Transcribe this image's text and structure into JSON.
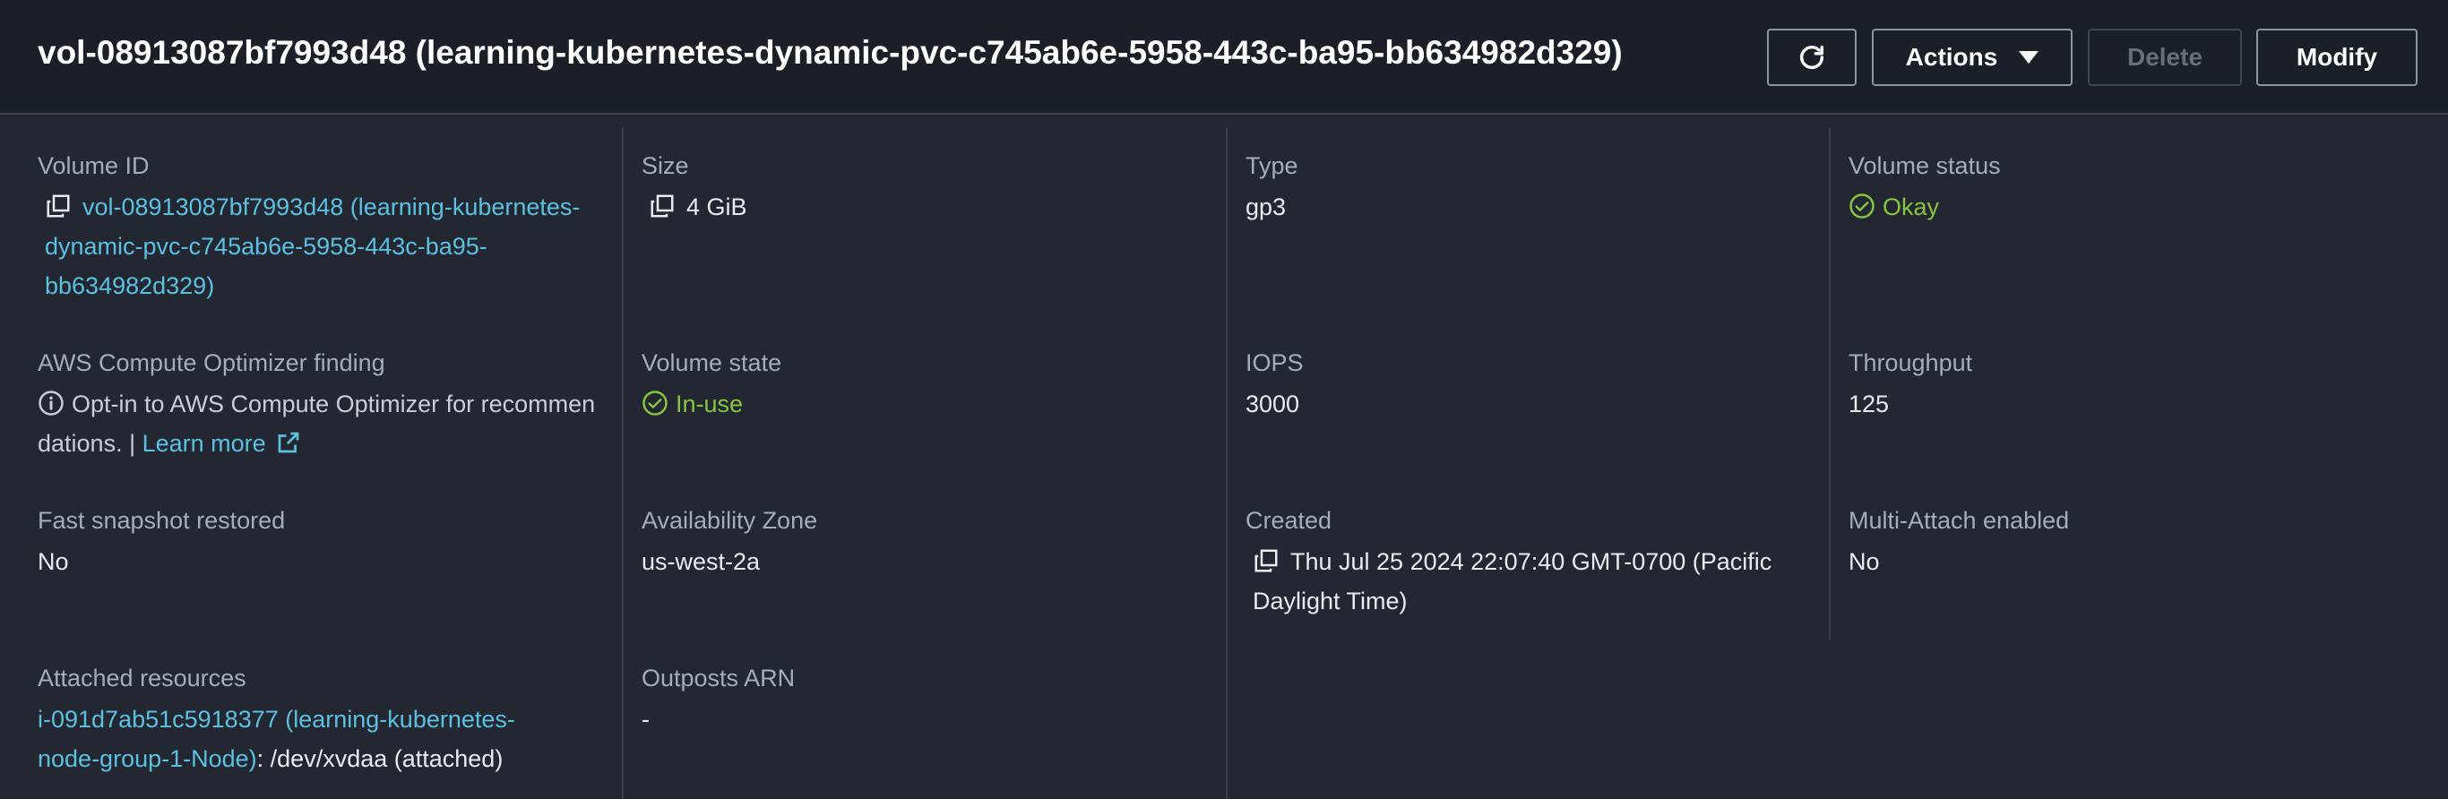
{
  "header": {
    "title": "vol-08913087bf7993d48 (learning-kubernetes-dynamic-pvc-c745ab6e-5958-443c-ba95-bb634982d329)",
    "refresh_icon": "refresh-icon",
    "actions_label": "Actions",
    "delete_label": "Delete",
    "modify_label": "Modify"
  },
  "details": {
    "volume_id": {
      "label": "Volume ID",
      "value": "vol-08913087bf7993d48 (learning-kubernetes-dynamic-pvc-c745ab6e-5958-443c-ba95-bb634982d329)",
      "icon": "copy-icon"
    },
    "size": {
      "label": "Size",
      "value": "4 GiB",
      "icon": "copy-icon"
    },
    "type": {
      "label": "Type",
      "value": "gp3"
    },
    "volume_status": {
      "label": "Volume status",
      "value": "Okay",
      "icon": "check-circle-icon"
    },
    "optimizer": {
      "label": "AWS Compute Optimizer finding",
      "value": "Opt-in to AWS Compute Optimizer for recommendations. |",
      "link": "Learn more",
      "icon": "info-icon",
      "link_icon": "external-link-icon"
    },
    "volume_state": {
      "label": "Volume state",
      "value": "In-use",
      "icon": "check-circle-icon"
    },
    "iops": {
      "label": "IOPS",
      "value": "3000"
    },
    "throughput": {
      "label": "Throughput",
      "value": "125"
    },
    "fast_snapshot": {
      "label": "Fast snapshot restored",
      "value": "No"
    },
    "availability_zone": {
      "label": "Availability Zone",
      "value": "us-west-2a"
    },
    "created": {
      "label": "Created",
      "value": "Thu Jul 25 2024 22:07:40 GMT-0700 (Pacific Daylight Time)",
      "icon": "copy-icon"
    },
    "multi_attach": {
      "label": "Multi-Attach enabled",
      "value": "No"
    },
    "attached_resources": {
      "label": "Attached resources",
      "link": "i-091d7ab51c5918377 (learning-kubernetes-node-group-1-Node)",
      "suffix": ": /dev/xvdaa (attached)"
    },
    "outposts_arn": {
      "label": "Outposts ARN",
      "value": "-"
    }
  },
  "colors": {
    "background": "#222731",
    "header_background": "#1b1f27",
    "link": "#5cc0e0",
    "status_ok": "#89c440",
    "label": "#a6adb8"
  }
}
